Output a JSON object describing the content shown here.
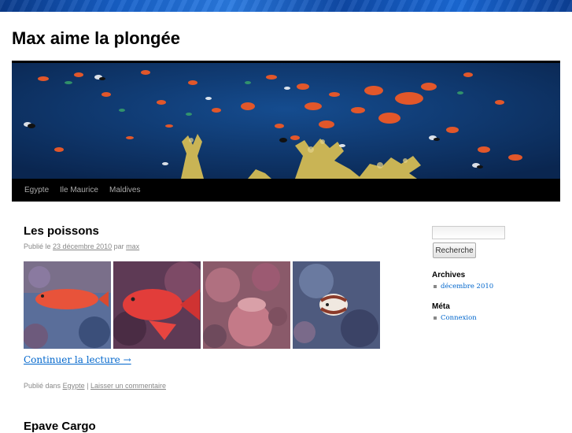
{
  "site": {
    "title": "Max aime la plongée"
  },
  "nav": {
    "items": [
      "Egypte",
      "Ile Maurice",
      "Maldives"
    ]
  },
  "post": {
    "title": "Les poissons",
    "meta_prefix": "Publié le",
    "date": "23 décembre 2010",
    "meta_by": "par",
    "author": "max",
    "continue": "Continuer la lecture →",
    "footer_prefix": "Publié dans",
    "category": "Egypte",
    "separator": "|",
    "comment_link": "Laisser un commentaire",
    "thumbnails": [
      "coral-grouper-1",
      "coral-grouper-2",
      "coral-reef",
      "lionfish"
    ]
  },
  "post2": {
    "title": "Epave Cargo"
  },
  "sidebar": {
    "search_button": "Recherche",
    "archives_title": "Archives",
    "archives_items": [
      "décembre 2010"
    ],
    "meta_title": "Méta",
    "meta_items": [
      "Connexion"
    ]
  },
  "colors": {
    "link": "#0066cc",
    "nav_bg": "#000000",
    "nav_text": "#aaaaaa"
  }
}
